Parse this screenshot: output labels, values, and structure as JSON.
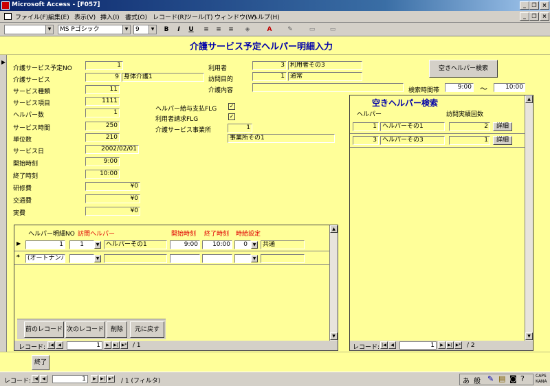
{
  "window": {
    "title": "Microsoft Access - [F057]"
  },
  "menu": [
    "ファイル(F)",
    "編集(E)",
    "表示(V)",
    "挿入(I)",
    "書式(O)",
    "レコード(R)",
    "ツール(T)",
    "ウィンドウ(W)",
    "ヘルプ(H)"
  ],
  "toolbar": {
    "font_name": "MS Pゴシック",
    "font_size": "9",
    "bold": "B",
    "italic": "I",
    "underline": "U"
  },
  "form": {
    "title": "介護サービス予定ヘルパー明細入力",
    "left_labels": [
      "介護サービス予定NO",
      "介護サービス",
      "サービス種類",
      "サービス項目",
      "ヘルパー数",
      "サービス時間",
      "単位数",
      "サービス日",
      "開始時刻",
      "終了時刻",
      "研修費",
      "交通費",
      "実費"
    ],
    "left_values": [
      "1",
      "9",
      "11",
      "1111",
      "1",
      "250",
      "210",
      "2002/02/01",
      "9:00",
      "10:00",
      "¥0",
      "¥0",
      "¥0"
    ],
    "service_name": "身体介護1",
    "user_label": "利用者",
    "user_no": "3",
    "user_name": "利用者その3",
    "purpose_label": "訪問目的",
    "purpose_no": "1",
    "purpose_name": "通常",
    "content_label": "介護内容",
    "content_value": "",
    "search_button": "空きヘルパー検索",
    "search_time_label": "検索時間帯",
    "search_from": "9:00",
    "tilde": "～",
    "search_to": "10:00",
    "helper_pay_label": "ヘルパー給与支払FLG",
    "user_bill_label": "利用者請求FLG",
    "office_label": "介護サービス事業所",
    "office_no": "1",
    "office_name": "事業所その1",
    "close_button": "終了"
  },
  "sub1": {
    "headers": [
      "ヘルパー明細NO",
      "訪問ヘルパー",
      "開始時刻",
      "終了時刻",
      "時給設定"
    ],
    "row1": {
      "no": "1",
      "helper_no": "1",
      "helper_name": "ヘルパーその1",
      "start": "9:00",
      "end": "10:00",
      "rate_no": "0",
      "rate_name": "共通"
    },
    "new_row_text": "(オートナンバー)",
    "buttons": [
      "前のレコード",
      "次のレコード",
      "削除",
      "元に戻す"
    ],
    "nav_label": "レコード:",
    "nav_value": "1",
    "nav_total": "/ 1"
  },
  "sub2": {
    "title": "空きヘルパー検索",
    "headers": [
      "ヘルパー",
      "訪問実績回数"
    ],
    "rows": [
      {
        "no": "1",
        "name": "ヘルパーその1",
        "count": "2",
        "btn": "詳細"
      },
      {
        "no": "3",
        "name": "ヘルパーその3",
        "count": "1",
        "btn": "詳細"
      }
    ],
    "nav_label": "レコード:",
    "nav_value": "1",
    "nav_total": "/ 2"
  },
  "status": {
    "nav_label": "レコード:",
    "nav_value": "1",
    "nav_total": "/ 1 (フィルタ)",
    "ime": "般",
    "caps": "CAPS",
    "kana": "KANA"
  }
}
